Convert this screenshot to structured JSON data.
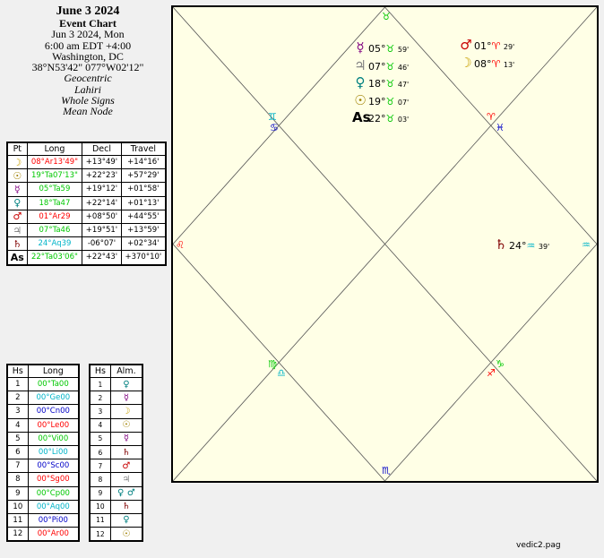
{
  "header": {
    "title": "June 3 2024",
    "subtitle": "Event Chart",
    "date": "Jun 3 2024, Mon",
    "time": "6:00 am  EDT +4:00",
    "place": "Washington, DC",
    "coords": "38°N53'42\" 077°W02'12\"",
    "zodiac": "Geocentric",
    "ayanamsa": "Lahiri",
    "houses": "Whole Signs",
    "node": "Mean Node"
  },
  "planets_table": {
    "headers": [
      "Pt",
      "Long",
      "Decl",
      "Travel"
    ],
    "rows": [
      {
        "glyph": "☽",
        "color": "#c8a000",
        "long": "08°Ar13'49\"",
        "long_color": "#ff0000",
        "decl": "+13°49'",
        "travel": "+14°16'"
      },
      {
        "glyph": "☉",
        "color": "#a08000",
        "long": "19°Ta07'13\"",
        "long_color": "#00c800",
        "decl": "+22°23'",
        "travel": "+57°29'"
      },
      {
        "glyph": "☿",
        "color": "#800080",
        "long": "05°Ta59",
        "long_color": "#00c800",
        "decl": "+19°12'",
        "travel": "+01°58'"
      },
      {
        "glyph": "♀",
        "color": "#008080",
        "long": "18°Ta47",
        "long_color": "#00c800",
        "decl": "+22°14'",
        "travel": "+01°13'"
      },
      {
        "glyph": "♂",
        "color": "#c80000",
        "long": "01°Ar29",
        "long_color": "#ff0000",
        "decl": "+08°50'",
        "travel": "+44°55'"
      },
      {
        "glyph": "♃",
        "color": "#808080",
        "long": "07°Ta46",
        "long_color": "#00c800",
        "decl": "+19°51'",
        "travel": "+13°59'"
      },
      {
        "glyph": "♄",
        "color": "#800000",
        "long": "24°Aq39",
        "long_color": "#00b4c8",
        "decl": "-06°07'",
        "travel": "+02°34'"
      },
      {
        "glyph": "As",
        "color": "#000000",
        "long": "22°Ta03'06\"",
        "long_color": "#00c800",
        "decl": "+22°43'",
        "travel": "+370°10'"
      }
    ]
  },
  "houses_table": {
    "headers": [
      "Hs",
      "Long"
    ],
    "rows": [
      {
        "hs": "1",
        "long": "00°Ta00",
        "color": "#00c800"
      },
      {
        "hs": "2",
        "long": "00°Ge00",
        "color": "#00b4c8"
      },
      {
        "hs": "3",
        "long": "00°Cn00",
        "color": "#0000c8"
      },
      {
        "hs": "4",
        "long": "00°Le00",
        "color": "#ff0000"
      },
      {
        "hs": "5",
        "long": "00°Vi00",
        "color": "#00c800"
      },
      {
        "hs": "6",
        "long": "00°Li00",
        "color": "#00b4c8"
      },
      {
        "hs": "7",
        "long": "00°Sc00",
        "color": "#0000c8"
      },
      {
        "hs": "8",
        "long": "00°Sg00",
        "color": "#ff0000"
      },
      {
        "hs": "9",
        "long": "00°Cp00",
        "color": "#00c800"
      },
      {
        "hs": "10",
        "long": "00°Aq00",
        "color": "#00b4c8"
      },
      {
        "hs": "11",
        "long": "00°Pi00",
        "color": "#0000c8"
      },
      {
        "hs": "12",
        "long": "00°Ar00",
        "color": "#ff0000"
      }
    ]
  },
  "almuten_table": {
    "headers": [
      "Hs",
      "Alm."
    ],
    "rows": [
      {
        "hs": "1",
        "glyph": "♀",
        "color": "#008080"
      },
      {
        "hs": "2",
        "glyph": "☿",
        "color": "#800080"
      },
      {
        "hs": "3",
        "glyph": "☽",
        "color": "#c8a000"
      },
      {
        "hs": "4",
        "glyph": "☉",
        "color": "#a08000"
      },
      {
        "hs": "5",
        "glyph": "☿",
        "color": "#800080"
      },
      {
        "hs": "6",
        "glyph": "♄",
        "color": "#800000"
      },
      {
        "hs": "7",
        "glyph": "♂",
        "color": "#c80000"
      },
      {
        "hs": "8",
        "glyph": "♃",
        "color": "#808080"
      },
      {
        "hs": "9",
        "glyph": "♀ ♂",
        "color": "#008080"
      },
      {
        "hs": "10",
        "glyph": "♄",
        "color": "#800000"
      },
      {
        "hs": "11",
        "glyph": "♀",
        "color": "#008080"
      },
      {
        "hs": "12",
        "glyph": "☉",
        "color": "#a08000"
      }
    ]
  },
  "chart": {
    "signs": [
      {
        "glyph": "♉",
        "color": "#00c800",
        "name": "taurus"
      },
      {
        "glyph": "♊",
        "color": "#00b4c8",
        "name": "gemini"
      },
      {
        "glyph": "♋",
        "color": "#0000c8",
        "name": "cancer"
      },
      {
        "glyph": "♌",
        "color": "#ff0000",
        "name": "leo"
      },
      {
        "glyph": "♍",
        "color": "#00c800",
        "name": "virgo"
      },
      {
        "glyph": "♎",
        "color": "#00b4c8",
        "name": "libra"
      },
      {
        "glyph": "♏",
        "color": "#0000c8",
        "name": "scorpio"
      },
      {
        "glyph": "♐",
        "color": "#ff0000",
        "name": "sagittarius"
      },
      {
        "glyph": "♑",
        "color": "#00c800",
        "name": "capricorn"
      },
      {
        "glyph": "♒",
        "color": "#00b4c8",
        "name": "aquarius"
      },
      {
        "glyph": "♓",
        "color": "#0000c8",
        "name": "pisces"
      },
      {
        "glyph": "♈",
        "color": "#ff0000",
        "name": "aries"
      }
    ],
    "house1_planets": [
      {
        "glyph": "☿",
        "color": "#800080",
        "deg": "05°",
        "sign": "♉",
        "sign_color": "#00c800",
        "min": "59'"
      },
      {
        "glyph": "♃",
        "color": "#808080",
        "deg": "07°",
        "sign": "♉",
        "sign_color": "#00c800",
        "min": "46'"
      },
      {
        "glyph": "♀",
        "color": "#008080",
        "deg": "18°",
        "sign": "♉",
        "sign_color": "#00c800",
        "min": "47'"
      },
      {
        "glyph": "☉",
        "color": "#a08000",
        "deg": "19°",
        "sign": "♉",
        "sign_color": "#00c800",
        "min": "07'"
      },
      {
        "glyph": "As",
        "color": "#000000",
        "deg": "22°",
        "sign": "♉",
        "sign_color": "#00c800",
        "min": "03'"
      }
    ],
    "house12_planets": [
      {
        "glyph": "♂",
        "color": "#c80000",
        "deg": "01°",
        "sign": "♈",
        "sign_color": "#ff0000",
        "min": "29'"
      },
      {
        "glyph": "☽",
        "color": "#c8a000",
        "deg": "08°",
        "sign": "♈",
        "sign_color": "#ff0000",
        "min": "13'"
      }
    ],
    "house10_planets": [
      {
        "glyph": "♄",
        "color": "#800000",
        "deg": "24°",
        "sign": "♒",
        "sign_color": "#00b4c8",
        "min": "39'"
      }
    ]
  },
  "footer": "vedic2.pag"
}
